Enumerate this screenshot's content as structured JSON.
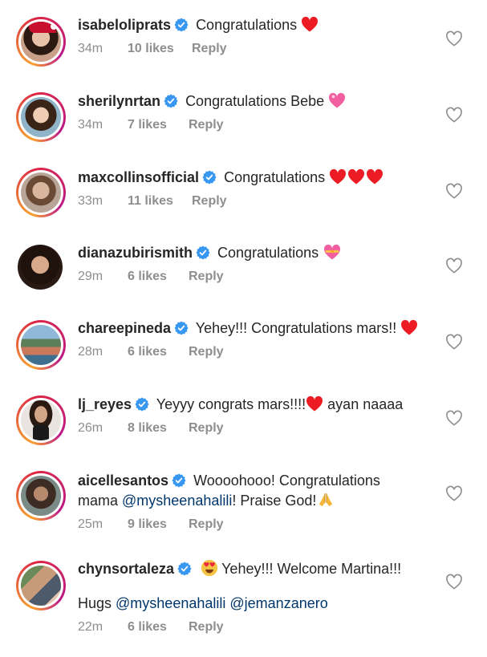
{
  "comments": [
    {
      "username": "isabeloliprats",
      "text": "Congratulations",
      "emoji": "red-heart",
      "time": "34m",
      "likes": "10 likes",
      "reply": "Reply"
    },
    {
      "username": "sherilynrtan",
      "text": "Congratulations Bebe",
      "emoji": "pink-heart",
      "time": "34m",
      "likes": "7 likes",
      "reply": "Reply"
    },
    {
      "username": "maxcollinsofficial",
      "text": "Congratulations",
      "emoji": "three-red-hearts",
      "time": "33m",
      "likes": "11 likes",
      "reply": "Reply"
    },
    {
      "username": "dianazubirismith",
      "text": "Congratulations",
      "emoji": "heart-with-ribbon",
      "time": "29m",
      "likes": "6 likes",
      "reply": "Reply"
    },
    {
      "username": "chareepineda",
      "text": "Yehey!!! Congratulations mars!!",
      "emoji": "red-heart",
      "time": "28m",
      "likes": "6 likes",
      "reply": "Reply"
    },
    {
      "username": "lj_reyes",
      "text_before": "Yeyyy congrats mars!!!!",
      "text_after": " ayan naaaa",
      "emoji": "red-heart",
      "time": "26m",
      "likes": "8 likes",
      "reply": "Reply"
    },
    {
      "username": "aicellesantos",
      "text_line1": "Woooohooo! Congratulations",
      "text_line2_prefix": "mama ",
      "mention": "@mysheenahalili",
      "text_line2_suffix": "! Praise God!",
      "emoji": "folded-hands",
      "time": "25m",
      "likes": "9 likes",
      "reply": "Reply"
    },
    {
      "username": "chynsortaleza",
      "emoji": "heart-eyes-face",
      "text": "Yehey!!! Welcome Martina!!!",
      "line2_prefix": "Hugs ",
      "mention1": "@mysheenahalili",
      "mention2": "@jemanzanero",
      "time": "22m",
      "likes": "6 likes",
      "reply": "Reply"
    }
  ],
  "colors": {
    "text": "#262626",
    "meta": "#8e8e8e",
    "verified": "#3897f0",
    "mention": "#00376b",
    "heart": "#ed1c24"
  }
}
